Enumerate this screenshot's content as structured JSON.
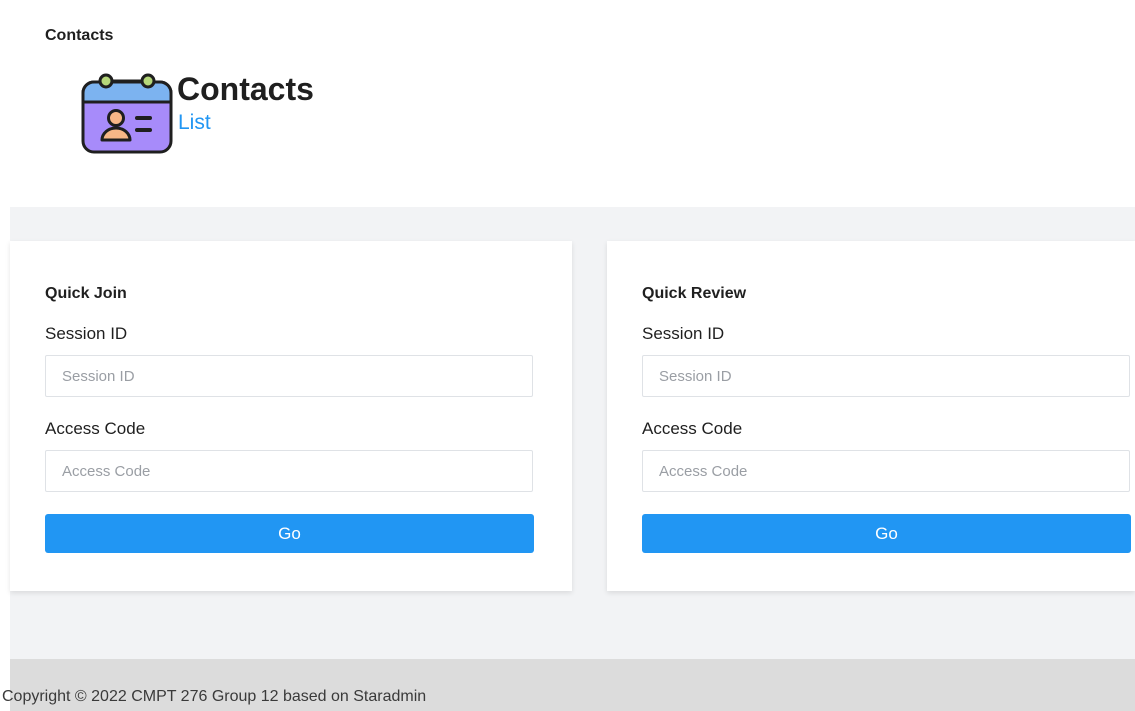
{
  "header": {
    "breadcrumb": "Contacts",
    "title": "Contacts",
    "subtitle": "List",
    "icon": "contact-card-icon"
  },
  "quick_join": {
    "title": "Quick Join",
    "session_label": "Session ID",
    "session_placeholder": "Session ID",
    "session_value": "",
    "access_label": "Access Code",
    "access_placeholder": "Access Code",
    "access_value": "",
    "go_label": "Go"
  },
  "quick_review": {
    "title": "Quick Review",
    "session_label": "Session ID",
    "session_placeholder": "Session ID",
    "session_value": "",
    "access_label": "Access Code",
    "access_placeholder": "Access Code",
    "access_value": "",
    "go_label": "Go"
  },
  "footer": {
    "text": "Copyright © 2022 CMPT 276 Group 12 based on Staradmin"
  },
  "colors": {
    "accent": "#2196f3",
    "content_background": "#f2f3f5",
    "footer_background": "#dcdcdc",
    "icon_card": "#a78bfa",
    "icon_header": "#7cb3f0",
    "icon_rings": "#b5d77a",
    "icon_person": "#f7b787"
  }
}
